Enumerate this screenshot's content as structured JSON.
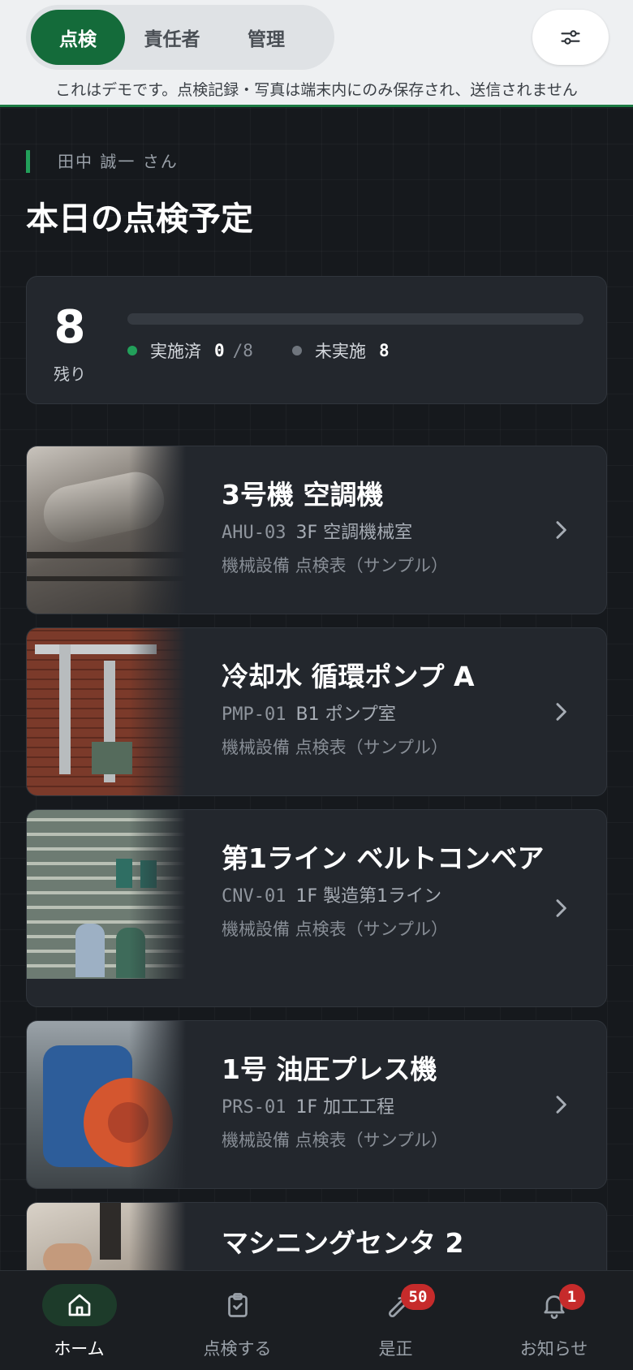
{
  "header": {
    "tabs": [
      {
        "label": "点検",
        "active": true
      },
      {
        "label": "責任者",
        "active": false
      },
      {
        "label": "管理",
        "active": false
      }
    ],
    "filter_icon": "sliders-icon"
  },
  "banner": "これはデモです。点検記録・写真は端末内にのみ保存され、送信されません",
  "user": "田中 誠一 さん",
  "title": "本日の点検予定",
  "summary": {
    "remaining": "8",
    "remaining_label": "残り",
    "done_label": "実施済",
    "done": "0",
    "total": "/8",
    "todo_label": "未実施",
    "todo": "8",
    "progress": 0
  },
  "equipment": [
    {
      "name": "3号機 空調機",
      "code": "AHU-03",
      "location": "3F 空調機械室",
      "sheet": "機械設備 点検表（サンプル）"
    },
    {
      "name": "冷却水 循環ポンプ A",
      "code": "PMP-01",
      "location": "B1 ポンプ室",
      "sheet": "機械設備 点検表（サンプル）"
    },
    {
      "name": "第1ライン ベルトコンベア",
      "code": "CNV-01",
      "location": "1F 製造第1ライン",
      "sheet": "機械設備 点検表（サンプル）"
    },
    {
      "name": "1号 油圧プレス機",
      "code": "PRS-01",
      "location": "1F 加工工程",
      "sheet": "機械設備 点検表（サンプル）"
    },
    {
      "name": "マシニングセンタ 2",
      "code": "",
      "location": "",
      "sheet": ""
    }
  ],
  "nav": [
    {
      "label": "ホーム",
      "icon": "home-icon",
      "badge": ""
    },
    {
      "label": "点検する",
      "icon": "clipboard-check-icon",
      "badge": ""
    },
    {
      "label": "是正",
      "icon": "wrench-icon",
      "badge": "50"
    },
    {
      "label": "お知らせ",
      "icon": "bell-icon",
      "badge": "1"
    }
  ],
  "colors": {
    "accent": "#146b3a",
    "badge": "#c62b2b",
    "background": "#16191d"
  }
}
